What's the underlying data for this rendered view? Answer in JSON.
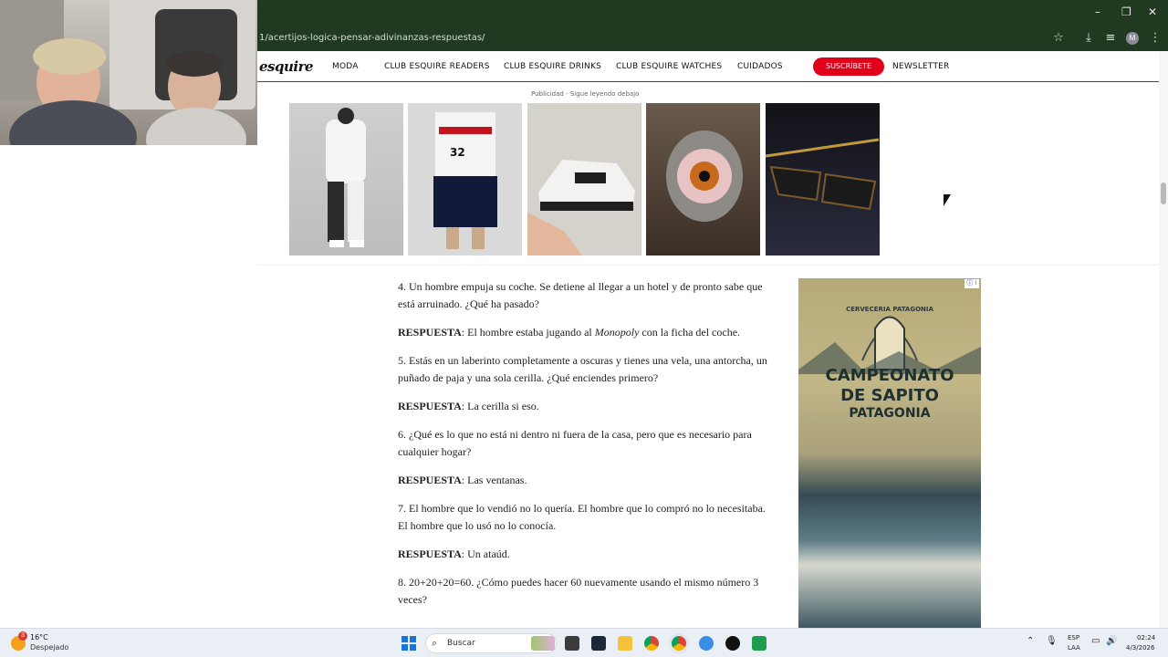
{
  "browser": {
    "url": "1/acertijos-logica-pensar-adivinanzas-respuestas/",
    "window_controls": [
      "–",
      "❐",
      "✕"
    ],
    "toolbar_icons": [
      "star-icon",
      "download-icon",
      "queue-icon",
      "profile-avatar",
      "menu-icon"
    ],
    "avatar_letter": "M"
  },
  "site_nav": {
    "logo": "esquire",
    "links": [
      "MODA",
      "CLUB ESQUIRE READERS",
      "CLUB ESQUIRE DRINKS",
      "CLUB ESQUIRE WATCHES",
      "CUIDADOS"
    ],
    "subscribe": "SUSCRÍBETE",
    "newsletter": "NEWSLETTER"
  },
  "ad_banner": {
    "label": "Publicidad - Sigue leyendo debajo",
    "items": [
      "tracksuit-product",
      "newyork-outfit-product",
      "sneaker-product",
      "eye-ring-product",
      "sunglasses-product"
    ]
  },
  "article": {
    "q4": "4. Un hombre empuja su coche. Se detiene al llegar a un hotel y de pronto sabe que está arruinado. ¿Qué ha pasado?",
    "a4_label": "RESPUESTA",
    "a4_pre": ": El hombre estaba jugando al ",
    "a4_em": "Monopoly",
    "a4_post": " con la ficha del coche.",
    "q5": "5. Estás en un laberinto completamente a oscuras y tienes una vela, una antorcha, un puñado de paja y una sola cerilla. ¿Qué enciendes primero?",
    "a5_label": "RESPUESTA",
    "a5": ": La cerilla si eso.",
    "q6": "6. ¿Qué es lo que no está ni dentro ni fuera de la casa, pero que es necesario para cualquier hogar?",
    "a6_label": "RESPUESTA",
    "a6": ": Las ventanas.",
    "q7": "7. El hombre que lo vendió no lo quería. El hombre que lo compró no lo necesitaba. El hombre que lo usó no lo conocía.",
    "a7_label": "RESPUESTA",
    "a7": ": Un ataúd.",
    "q8": "8. 20+20+20=60. ¿Cómo puedes hacer 60 nuevamente usando el mismo número 3 veces?"
  },
  "side_ad": {
    "line1": "CAMPEONATO",
    "line2": "DE SAPITO",
    "line3": "PATAGONIA",
    "arc_text": "CERVECERIA PATAGONIA"
  },
  "taskbar": {
    "temperature": "16°C",
    "weather": "Despejado",
    "weather_badge": "3",
    "search_label": "Buscar",
    "lang_top": "ESP",
    "lang_bottom": "LAA",
    "time": "02:24",
    "date": "4/3/2026"
  },
  "colors": {
    "browser_dark": "#1f3a20",
    "accent_red": "#e1001a",
    "taskbar_bg": "#eaeff5"
  }
}
